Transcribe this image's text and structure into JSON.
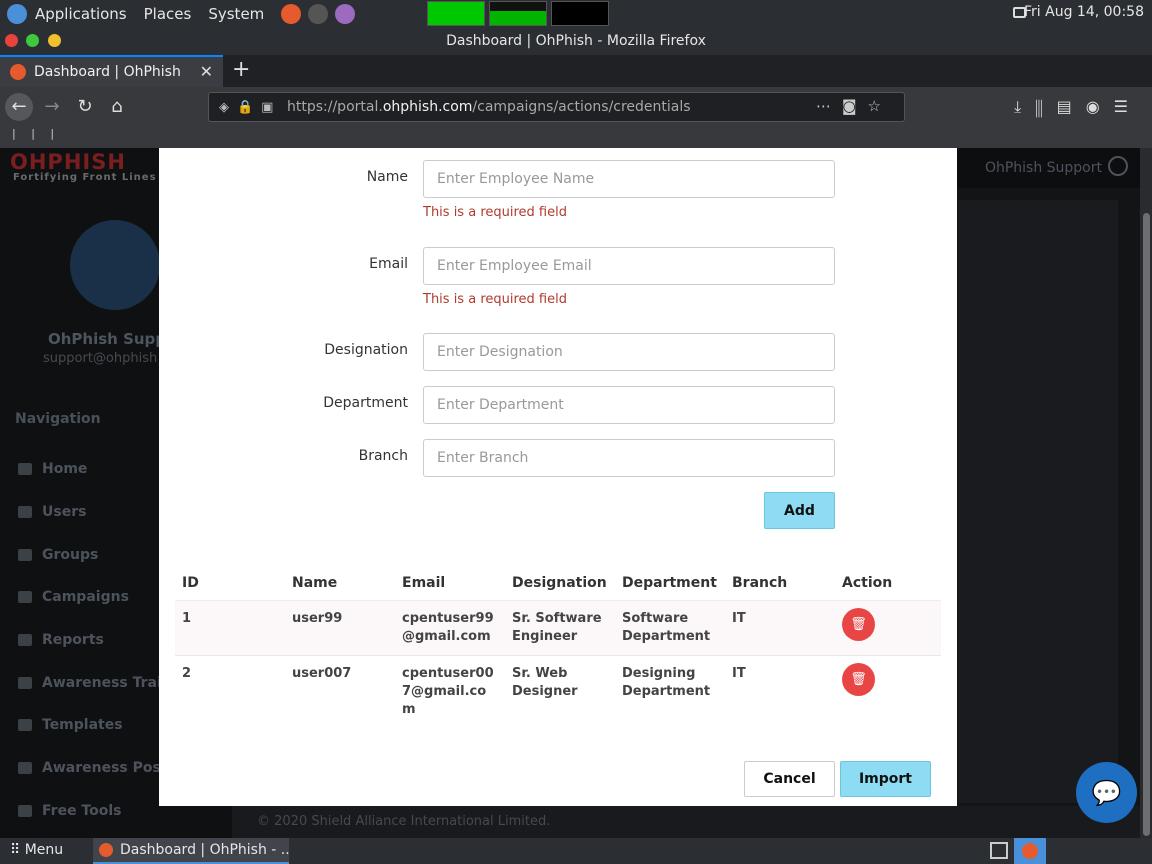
{
  "os_panel": {
    "menus": [
      "Applications",
      "Places",
      "System"
    ],
    "clock": "Fri Aug 14, 00:58"
  },
  "browser": {
    "window_title": "Dashboard | OhPhish - Mozilla Firefox",
    "tab_title": "Dashboard | OhPhish",
    "url_prefix": "https://portal.",
    "url_host": "ohphish.com",
    "url_path": "/campaigns/actions/credentials",
    "bookmarks_text": "| | |"
  },
  "app": {
    "logo": "OHPHISH",
    "tagline": "Fortifying Front Lines",
    "profile_name": "OhPhish Supp",
    "profile_email": "support@ohphish",
    "nav_heading": "Navigation",
    "nav_items": [
      "Home",
      "Users",
      "Groups",
      "Campaigns",
      "Reports",
      "Awareness Trai",
      "Templates",
      "Awareness Post",
      "Free Tools"
    ],
    "support_label": "OhPhish Support",
    "footer": "© 2020 Shield Alliance International Limited."
  },
  "modal": {
    "fields": {
      "name": {
        "label": "Name",
        "placeholder": "Enter Employee Name",
        "error": "This is a required field"
      },
      "email": {
        "label": "Email",
        "placeholder": "Enter Employee Email",
        "error": "This is a required field"
      },
      "designation": {
        "label": "Designation",
        "placeholder": "Enter Designation"
      },
      "department": {
        "label": "Department",
        "placeholder": "Enter Department"
      },
      "branch": {
        "label": "Branch",
        "placeholder": "Enter Branch"
      }
    },
    "add_label": "Add",
    "table": {
      "headers": [
        "ID",
        "Name",
        "Email",
        "Designation",
        "Department",
        "Branch",
        "Action"
      ],
      "rows": [
        {
          "id": "1",
          "name": "user99",
          "email": "cpentuser99 @gmail.com",
          "designation": "Sr. Software Engineer",
          "department": "Software Department",
          "branch": "IT"
        },
        {
          "id": "2",
          "name": "user007",
          "email": "cpentuser00 7@gmail.co m",
          "designation": "Sr. Web Designer",
          "department": "Designing Department",
          "branch": "IT"
        }
      ]
    },
    "cancel_label": "Cancel",
    "import_label": "Import"
  },
  "taskbar": {
    "menu_label": "Menu",
    "task_label": "Dashboard | OhPhish - ..."
  },
  "colors": {
    "accent_button": "#8ddcf3",
    "error_text": "#b03a2e",
    "delete_button": "#e84545",
    "chat_bubble": "#1e6fc2"
  }
}
